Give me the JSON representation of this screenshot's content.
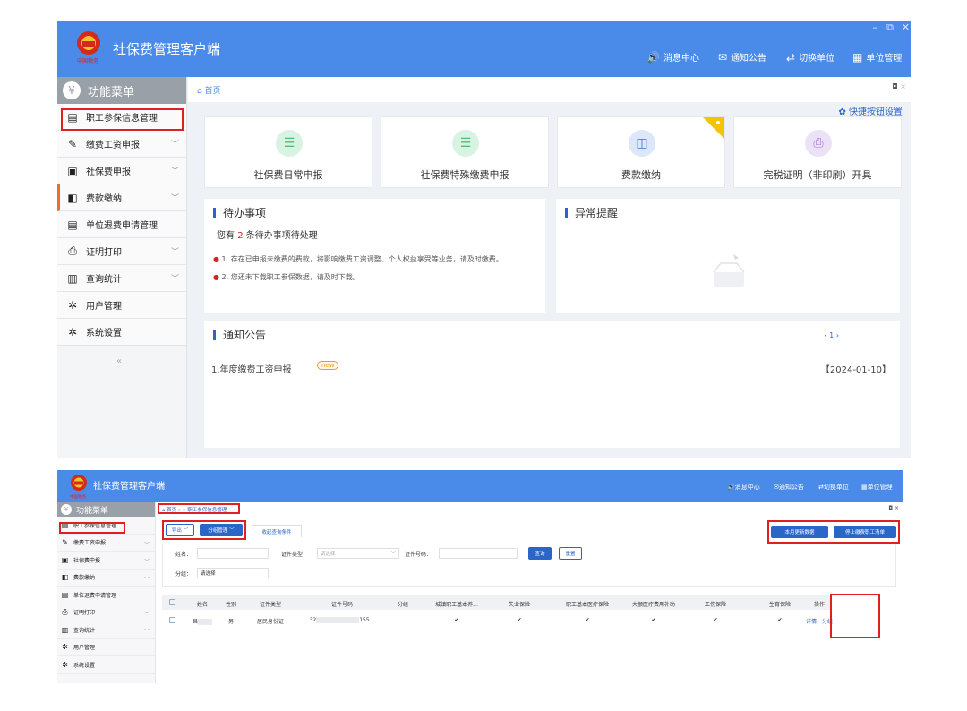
{
  "app": {
    "title": "社保费管理客户端",
    "window_controls": [
      "–",
      "⧉",
      "✕"
    ]
  },
  "header_nav": [
    {
      "label": "消息中心",
      "icon": "bell-icon"
    },
    {
      "label": "通知公告",
      "icon": "mail-icon"
    },
    {
      "label": "切换单位",
      "icon": "switch-icon"
    },
    {
      "label": "单位管理",
      "icon": "building-icon"
    }
  ],
  "sidebar": {
    "title": "功能菜单",
    "items": [
      {
        "label": "职工参保信息管理",
        "icon": "list-icon",
        "has_children": false
      },
      {
        "label": "缴费工资申报",
        "icon": "edit-icon",
        "has_children": true
      },
      {
        "label": "社保费申报",
        "icon": "doc-icon",
        "has_children": true
      },
      {
        "label": "费款缴纳",
        "icon": "bookmark-icon",
        "has_children": true
      },
      {
        "label": "单位退费申请管理",
        "icon": "list-icon",
        "has_children": false
      },
      {
        "label": "证明打印",
        "icon": "print-icon",
        "has_children": true
      },
      {
        "label": "查询统计",
        "icon": "chart-icon",
        "has_children": true
      },
      {
        "label": "用户管理",
        "icon": "gear-icon",
        "has_children": false
      },
      {
        "label": "系统设置",
        "icon": "gear-icon",
        "has_children": false
      }
    ],
    "collapse_glyph": "«"
  },
  "home": {
    "breadcrumb": "首页",
    "quick_settings": "快捷按钮设置",
    "cards": [
      {
        "label": "社保费日常申报",
        "icon": "form-icon",
        "color": "#4cbf7a"
      },
      {
        "label": "社保费特殊缴费申报",
        "icon": "form-icon",
        "color": "#4cbf7a"
      },
      {
        "label": "费款缴纳",
        "icon": "bookmark-icon",
        "color": "#3a6fd0"
      },
      {
        "label": "完税证明（非印刷）开具",
        "icon": "printer-icon",
        "color": "#a070d0"
      }
    ],
    "todo": {
      "title": "待办事项",
      "count_prefix": "您有",
      "count": "2",
      "count_suffix": "条待办事项待处理",
      "items": [
        "1. 存在已申报未缴费的费款，将影响缴费工资调整、个人权益享受等业务，请及时缴费。",
        "2. 您还未下载职工参保数据，请及时下载。"
      ]
    },
    "alerts": {
      "title": "异常提醒"
    },
    "notices": {
      "title": "通知公告",
      "pager": "‹ 1 ›",
      "items": [
        {
          "title": "1.年度缴费工资申报",
          "tag": "new",
          "date": "【2024-01-10】"
        }
      ]
    }
  },
  "detail": {
    "app_title": "社保费管理客户端",
    "header_nav": [
      "消息中心",
      "通知公告",
      "切换单位",
      "单位管理"
    ],
    "sidebar_title": "功能菜单",
    "breadcrumb": "首页 » » 职工参保信息管理",
    "close": "◘ ×",
    "toolbar": {
      "export": "导出",
      "group_manage": "分组管理",
      "filter_tab": "收起查询条件",
      "month_update": "本月更新数据",
      "stop_payment_list": "停止缴费职工清单"
    },
    "form": {
      "name_label": "姓名：",
      "id_type_label": "证件类型：",
      "id_type_placeholder": "请选择",
      "id_no_label": "证件号码：",
      "group_label": "分组：",
      "group_placeholder": "请选择",
      "query": "查询",
      "reset": "重置"
    },
    "table": {
      "columns": [
        "姓名",
        "性别",
        "证件类型",
        "证件号码",
        "分组",
        "城镇职工基本养...",
        "失业保险",
        "职工基本医疗保险",
        "大额医疗费用补助",
        "工伤保险",
        "生育保险",
        "操作"
      ],
      "rows": [
        {
          "name": "吕",
          "gender": "男",
          "id_type": "居民身份证",
          "id_no_start": "32",
          "id_no_end": "155...",
          "group": "",
          "checks": [
            "✔",
            "✔",
            "✔",
            "✔",
            "✔",
            "✔"
          ],
          "actions": [
            "详情",
            "分组"
          ]
        }
      ]
    }
  }
}
